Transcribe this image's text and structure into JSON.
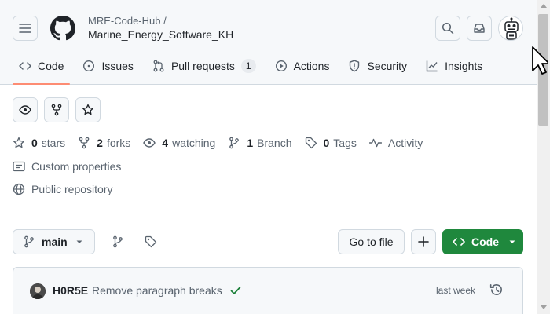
{
  "header": {
    "owner": "MRE-Code-Hub /",
    "repo": "Marine_Energy_Software_KH"
  },
  "tabs": [
    {
      "label": "Code",
      "icon": "code-icon",
      "selected": true
    },
    {
      "label": "Issues",
      "icon": "issue-icon"
    },
    {
      "label": "Pull requests",
      "icon": "pull-request-icon",
      "count": "1"
    },
    {
      "label": "Actions",
      "icon": "play-icon"
    },
    {
      "label": "Security",
      "icon": "shield-icon"
    },
    {
      "label": "Insights",
      "icon": "graph-icon"
    }
  ],
  "stats": {
    "stars_count": "0",
    "stars_label": "stars",
    "forks_count": "2",
    "forks_label": "forks",
    "watching_count": "4",
    "watching_label": "watching",
    "branch_count": "1",
    "branch_label": "Branch",
    "tags_count": "0",
    "tags_label": "Tags",
    "activity_label": "Activity"
  },
  "meta": {
    "custom_properties": "Custom properties",
    "visibility": "Public repository"
  },
  "toolbar": {
    "branch": "main",
    "go_to_file": "Go to file",
    "code": "Code"
  },
  "commit": {
    "author": "H0R5E",
    "message": "Remove paragraph breaks",
    "time": "last week",
    "status": "success"
  },
  "colors": {
    "accent_underline": "#fd8c73",
    "primary_button": "#1f883d",
    "success": "#1a7f37"
  }
}
